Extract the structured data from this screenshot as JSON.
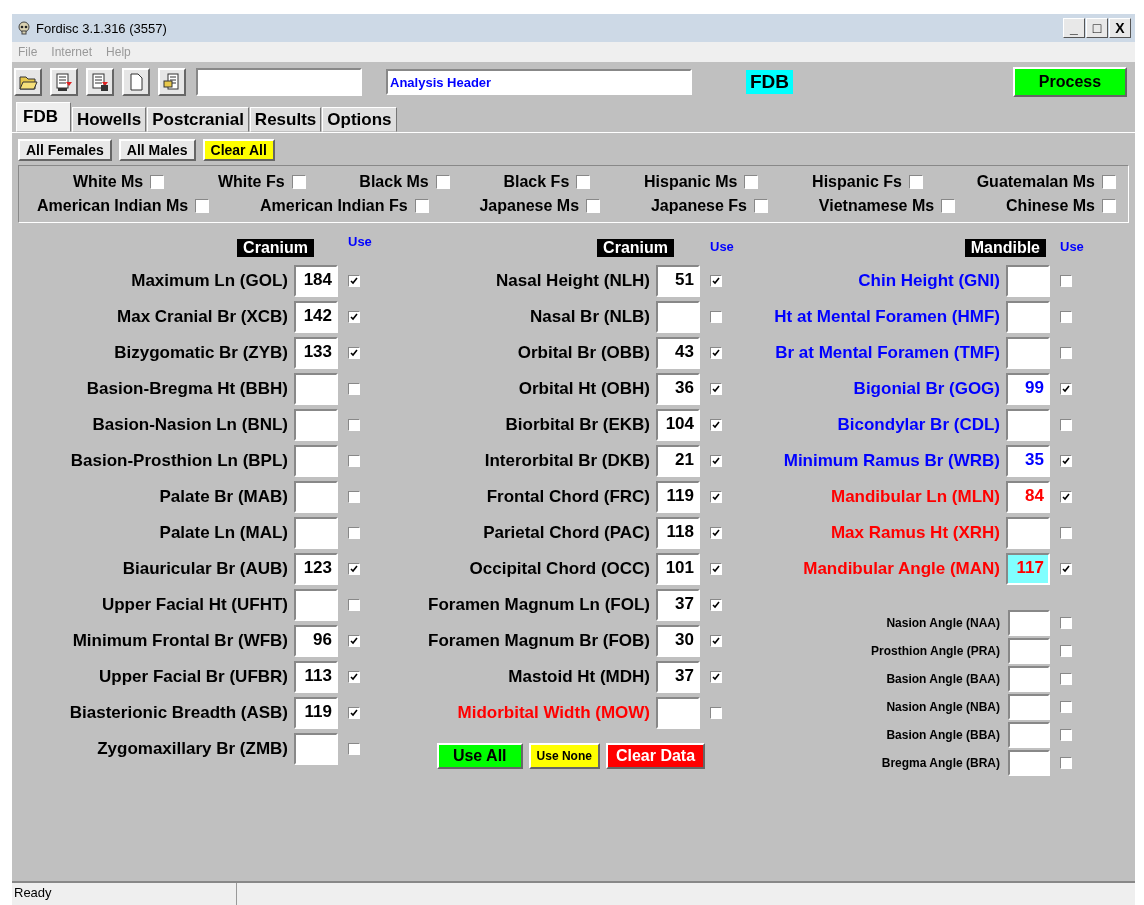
{
  "window": {
    "title": "Fordisc 3.1.316 (3557)",
    "controls": [
      "_",
      "□",
      "X"
    ]
  },
  "menu": [
    {
      "label": "File",
      "disabled": true
    },
    {
      "label": "Internet",
      "disabled": true
    },
    {
      "label": "Help",
      "disabled": true
    }
  ],
  "toolbar": {
    "header_field": {
      "value": "Analysis Header"
    },
    "badge": "FDB",
    "process_button": "Process"
  },
  "tabs": [
    {
      "label": "FDB",
      "selected": true
    },
    {
      "label": "Howells",
      "selected": false
    },
    {
      "label": "Postcranial",
      "selected": false
    },
    {
      "label": "Results",
      "selected": false
    },
    {
      "label": "Options",
      "selected": false
    }
  ],
  "group_buttons": [
    {
      "label": "All Females",
      "kind": "plain"
    },
    {
      "label": "All Males",
      "kind": "plain"
    },
    {
      "label": "Clear All",
      "kind": "yellow"
    }
  ],
  "groups": [
    [
      {
        "label": "White Ms",
        "checked": false
      },
      {
        "label": "White Fs",
        "checked": false
      },
      {
        "label": "Black Ms",
        "checked": false
      },
      {
        "label": "Black Fs",
        "checked": false
      },
      {
        "label": "Hispanic Ms",
        "checked": false
      },
      {
        "label": "Hispanic Fs",
        "checked": false
      },
      {
        "label": "Guatemalan Ms",
        "checked": false
      }
    ],
    [
      {
        "label": "American Indian Ms",
        "checked": false
      },
      {
        "label": "American Indian Fs",
        "checked": false
      },
      {
        "label": "Japanese Ms",
        "checked": false
      },
      {
        "label": "Japanese Fs",
        "checked": false
      },
      {
        "label": "Vietnamese Ms",
        "checked": false
      },
      {
        "label": "Chinese Ms",
        "checked": false
      }
    ]
  ],
  "columns": [
    {
      "heading": "Cranium",
      "use_label": "Use",
      "rows": [
        {
          "label": "Maximum Ln (GOL)",
          "value": "184",
          "checked": true,
          "color": "#000000",
          "highlighted": false
        },
        {
          "label": "Max Cranial Br (XCB)",
          "value": "142",
          "checked": true,
          "color": "#000000",
          "highlighted": false
        },
        {
          "label": "Bizygomatic Br (ZYB)",
          "value": "133",
          "checked": true,
          "color": "#000000",
          "highlighted": false
        },
        {
          "label": "Basion-Bregma Ht (BBH)",
          "checked": false,
          "color": "#000000",
          "highlighted": false
        },
        {
          "label": "Basion-Nasion Ln (BNL)",
          "checked": false,
          "color": "#000000",
          "highlighted": false
        },
        {
          "label": "Basion-Prosthion Ln (BPL)",
          "checked": false,
          "color": "#000000",
          "highlighted": false
        },
        {
          "label": "Palate Br (MAB)",
          "checked": false,
          "color": "#000000",
          "highlighted": false
        },
        {
          "label": "Palate Ln (MAL)",
          "checked": false,
          "color": "#000000",
          "highlighted": false
        },
        {
          "label": "Biauricular Br (AUB)",
          "value": "123",
          "checked": true,
          "color": "#000000",
          "highlighted": false
        },
        {
          "label": "Upper Facial Ht (UFHT)",
          "checked": false,
          "color": "#000000",
          "highlighted": false
        },
        {
          "label": "Minimum Frontal Br (WFB)",
          "value": "96",
          "checked": true,
          "color": "#000000",
          "highlighted": false
        },
        {
          "label": "Upper Facial Br (UFBR)",
          "value": "113",
          "checked": true,
          "color": "#000000",
          "highlighted": false
        },
        {
          "label": "Biasterionic Breadth (ASB)",
          "value": "119",
          "checked": true,
          "color": "#000000",
          "highlighted": false
        },
        {
          "label": "Zygomaxillary Br (ZMB)",
          "checked": false,
          "color": "#000000",
          "highlighted": false
        }
      ]
    },
    {
      "heading": "Cranium",
      "use_label": "Use",
      "rows": [
        {
          "label": "Nasal Height (NLH)",
          "value": "51",
          "checked": true,
          "color": "#000000",
          "highlighted": false
        },
        {
          "label": "Nasal Br (NLB)",
          "checked": false,
          "color": "#000000",
          "highlighted": false
        },
        {
          "label": "Orbital Br (OBB)",
          "value": "43",
          "checked": true,
          "color": "#000000",
          "highlighted": false
        },
        {
          "label": "Orbital Ht (OBH)",
          "value": "36",
          "checked": true,
          "color": "#000000",
          "highlighted": false
        },
        {
          "label": "Biorbital Br (EKB)",
          "value": "104",
          "checked": true,
          "color": "#000000",
          "highlighted": false
        },
        {
          "label": "Interorbital Br (DKB)",
          "value": "21",
          "checked": true,
          "color": "#000000",
          "highlighted": false
        },
        {
          "label": "Frontal Chord (FRC)",
          "value": "119",
          "checked": true,
          "color": "#000000",
          "highlighted": false
        },
        {
          "label": "Parietal Chord (PAC)",
          "value": "118",
          "checked": true,
          "color": "#000000",
          "highlighted": false
        },
        {
          "label": "Occipital Chord (OCC)",
          "value": "101",
          "checked": true,
          "color": "#000000",
          "highlighted": false
        },
        {
          "label": "Foramen Magnum Ln (FOL)",
          "value": "37",
          "checked": true,
          "color": "#000000",
          "highlighted": false
        },
        {
          "label": "Foramen Magnum Br (FOB)",
          "value": "30",
          "checked": true,
          "color": "#000000",
          "highlighted": false
        },
        {
          "label": "Mastoid Ht (MDH)",
          "value": "37",
          "checked": true,
          "color": "#000000",
          "highlighted": false
        },
        {
          "label": "Midorbital Width (MOW)",
          "checked": false,
          "color": "#ff0000",
          "highlighted": false
        }
      ]
    },
    {
      "heading": "Mandible",
      "use_label": "Use",
      "rows": [
        {
          "label": "Chin Height (GNI)",
          "checked": false,
          "color": "#0000ff",
          "highlighted": false
        },
        {
          "label": "Ht at Mental Foramen (HMF)",
          "checked": false,
          "color": "#0000ff",
          "highlighted": false
        },
        {
          "label": "Br at Mental Foramen (TMF)",
          "checked": false,
          "color": "#0000ff",
          "highlighted": false
        },
        {
          "label": "Bigonial Br (GOG)",
          "value": "99",
          "checked": true,
          "color": "#0000ff",
          "highlighted": false
        },
        {
          "label": "Bicondylar Br (CDL)",
          "checked": false,
          "color": "#0000ff",
          "highlighted": false
        },
        {
          "label": "Minimum Ramus Br (WRB)",
          "value": "35",
          "checked": true,
          "color": "#0000ff",
          "highlighted": false
        },
        {
          "label": "Mandibular Ln (MLN)",
          "value": "84",
          "checked": true,
          "color": "#ff0000",
          "highlighted": false
        },
        {
          "label": "Max Ramus Ht (XRH)",
          "checked": false,
          "color": "#ff0000",
          "highlighted": false
        },
        {
          "label": "Mandibular Angle (MAN)",
          "value": "117",
          "checked": true,
          "color": "#ff0000",
          "highlighted": true
        }
      ]
    }
  ],
  "angles": [
    {
      "label": "Nasion Angle (NAA)",
      "checked": false
    },
    {
      "label": "Prosthion Angle (PRA)",
      "checked": false
    },
    {
      "label": "Basion Angle (BAA)",
      "checked": false
    },
    {
      "label": "Nasion Angle (NBA)",
      "checked": false
    },
    {
      "label": "Basion Angle (BBA)",
      "checked": false
    },
    {
      "label": "Bregma Angle (BRA)",
      "checked": false
    }
  ],
  "action_buttons": [
    {
      "label": "Use All",
      "kind": "green"
    },
    {
      "label": "Use None",
      "kind": "yellow"
    },
    {
      "label": "Clear Data",
      "kind": "red"
    }
  ],
  "status_bar": "Ready"
}
